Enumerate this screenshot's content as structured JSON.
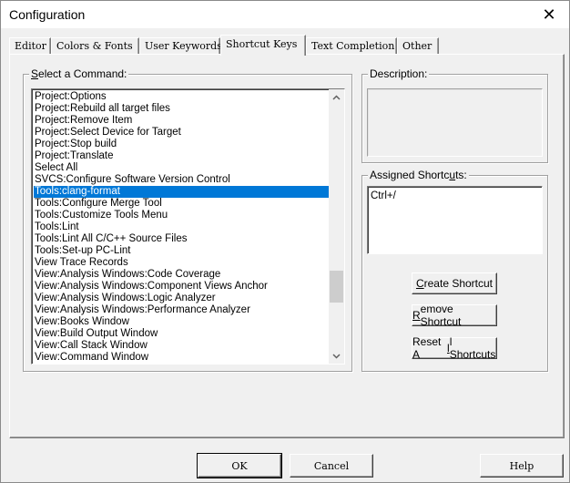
{
  "window": {
    "title": "Configuration",
    "close_glyph": "✕"
  },
  "tabs": [
    {
      "label": "Editor"
    },
    {
      "label": "Colors & Fonts"
    },
    {
      "label": "User Keywords"
    },
    {
      "label": "Shortcut Keys",
      "active": true
    },
    {
      "label": "Text Completion"
    },
    {
      "label": "Other"
    }
  ],
  "command_group": {
    "label_prefix": "",
    "label_accel": "S",
    "label_rest": "elect a Command:",
    "items": [
      "Project:Options",
      "Project:Rebuild all target files",
      "Project:Remove Item",
      "Project:Select Device for Target",
      "Project:Stop build",
      "Project:Translate",
      "Select All",
      "SVCS:Configure Software Version Control",
      "Tools:clang-format",
      "Tools:Configure Merge Tool",
      "Tools:Customize Tools Menu",
      "Tools:Lint",
      "Tools:Lint All C/C++ Source Files",
      "Tools:Set-up PC-Lint",
      "View Trace Records",
      "View:Analysis Windows:Code Coverage",
      "View:Analysis Windows:Component Views Anchor",
      "View:Analysis Windows:Logic Analyzer",
      "View:Analysis Windows:Performance Analyzer",
      "View:Books Window",
      "View:Build Output Window",
      "View:Call Stack Window",
      "View:Command Window"
    ],
    "selected_index": 8,
    "scroll_up_icon": "chevron-up-icon",
    "scroll_down_icon": "chevron-down-icon"
  },
  "description_group": {
    "label": "Description:",
    "text": ""
  },
  "shortcuts_group": {
    "label_prefix": "Assigned Shortc",
    "label_accel": "u",
    "label_rest": "ts:",
    "value": "Ctrl+/"
  },
  "buttons": {
    "create": {
      "prefix": "",
      "accel": "C",
      "rest": "reate Shortcut"
    },
    "remove": {
      "prefix": "",
      "accel": "R",
      "rest": "emove Shortcut"
    },
    "reset": {
      "prefix": "Reset A",
      "accel": "l",
      "rest": "l Shortcuts"
    },
    "ok": "OK",
    "cancel": "Cancel",
    "help": "Help"
  },
  "colors": {
    "selection": "#0078d7",
    "dialog_bg": "#f0f0f0"
  }
}
